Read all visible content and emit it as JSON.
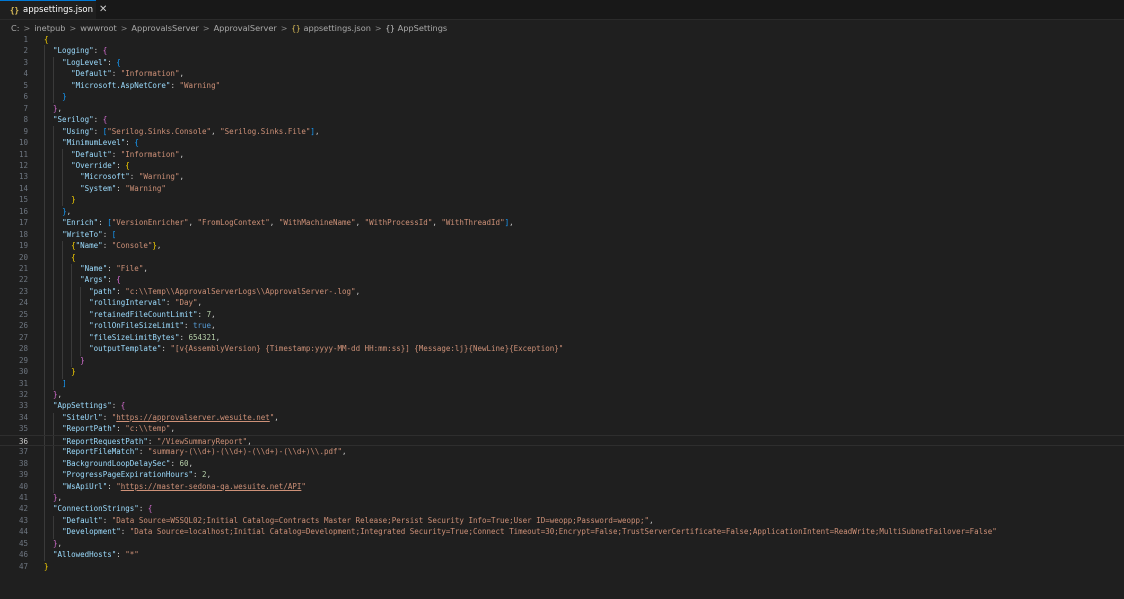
{
  "tab": {
    "icon": "{}",
    "title": "appsettings.json",
    "close": "✕"
  },
  "breadcrumb": {
    "items": [
      "C:",
      "inetpub",
      "wwwroot",
      "ApprovalsServer",
      "ApprovalServer",
      "appsettings.json",
      "AppSettings"
    ],
    "file_icon": "{}",
    "symbol_icon": "{}"
  },
  "editor": {
    "active_line": 36,
    "line_count": 47
  }
}
